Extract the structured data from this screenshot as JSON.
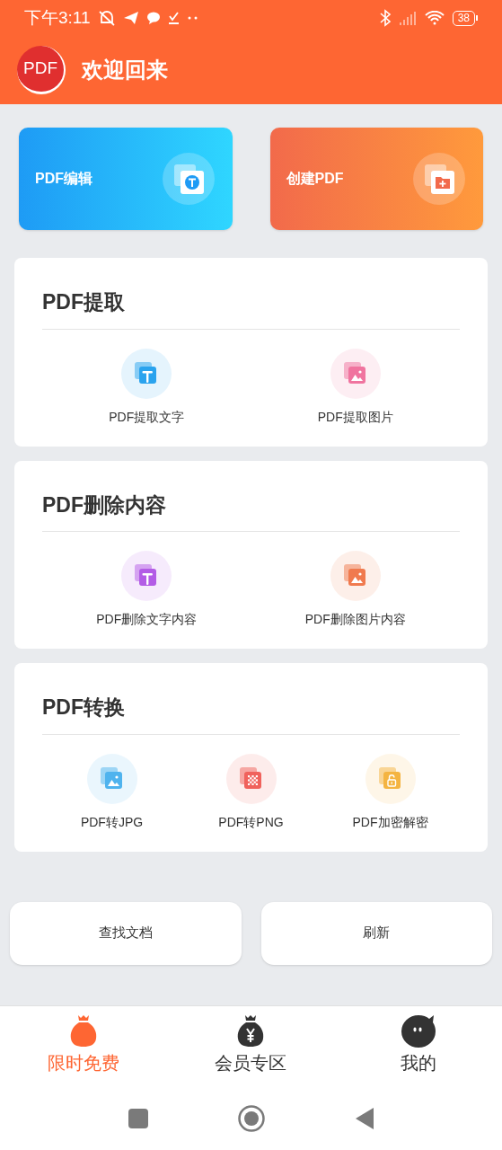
{
  "status_bar": {
    "time": "下午3:11",
    "battery": "38"
  },
  "header": {
    "logo": "PDF",
    "title": "欢迎回来"
  },
  "top_cards": [
    {
      "label": "PDF编辑",
      "kind": "text",
      "color": "#1e9bf5"
    },
    {
      "label": "创建PDF",
      "kind": "folder",
      "color": "#f26a4b"
    }
  ],
  "sections": [
    {
      "title": "PDF提取",
      "tools": [
        {
          "label": "PDF提取文字",
          "kind": "text",
          "color": "#2aa3ee"
        },
        {
          "label": "PDF提取图片",
          "kind": "image",
          "color": "#f0749f"
        }
      ]
    },
    {
      "title": "PDF删除内容",
      "tools": [
        {
          "label": "PDF删除文字内容",
          "kind": "text",
          "color": "#b35ce6"
        },
        {
          "label": "PDF删除图片内容",
          "kind": "image",
          "color": "#f07a4e"
        }
      ]
    },
    {
      "title": "PDF转换",
      "tools": [
        {
          "label": "PDF转JPG",
          "kind": "image",
          "color": "#4fb3ee"
        },
        {
          "label": "PDF转PNG",
          "kind": "mosaic",
          "color": "#f0625c"
        },
        {
          "label": "PDF加密解密",
          "kind": "lock",
          "color": "#f4b441"
        }
      ]
    }
  ],
  "buttons": [
    "查找文档",
    "刷新"
  ],
  "bottom_nav": [
    {
      "label": "限时免费",
      "kind": "bag",
      "selected": true
    },
    {
      "label": "会员专区",
      "kind": "yen",
      "selected": false
    },
    {
      "label": "我的",
      "kind": "face",
      "selected": false
    }
  ]
}
